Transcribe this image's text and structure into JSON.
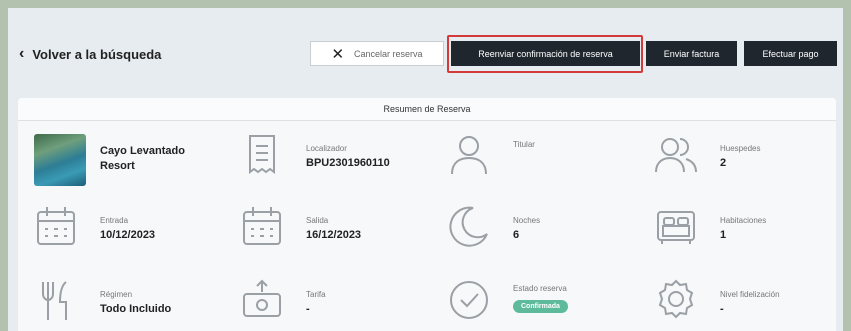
{
  "header": {
    "back_label": "Volver a la búsqueda",
    "cancel_label": "Cancelar reserva",
    "resend_label": "Reenviar confirmación de reserva",
    "invoice_label": "Enviar factura",
    "pay_label": "Efectuar pago"
  },
  "summary": {
    "title": "Resumen de Reserva",
    "hotel_name": "Cayo Levantado Resort",
    "locator_label": "Localizador",
    "locator_value": "BPU2301960110",
    "holder_label": "Titular",
    "guests_label": "Huespedes",
    "guests_value": "2",
    "checkin_label": "Entrada",
    "checkin_value": "10/12/2023",
    "checkout_label": "Salida",
    "checkout_value": "16/12/2023",
    "nights_label": "Noches",
    "nights_value": "6",
    "rooms_label": "Habitaciones",
    "rooms_value": "1",
    "board_label": "Régimen",
    "board_value": "Todo Incluido",
    "rate_label": "Tarifa",
    "rate_value": "-",
    "status_label": "Estado reserva",
    "status_value": "Confirmada",
    "loyalty_label": "Nivel fidelización",
    "loyalty_value": "-"
  },
  "colors": {
    "highlight": "#d43a3a",
    "dark_button": "#1f262d",
    "status_badge": "#5dbb9c"
  }
}
